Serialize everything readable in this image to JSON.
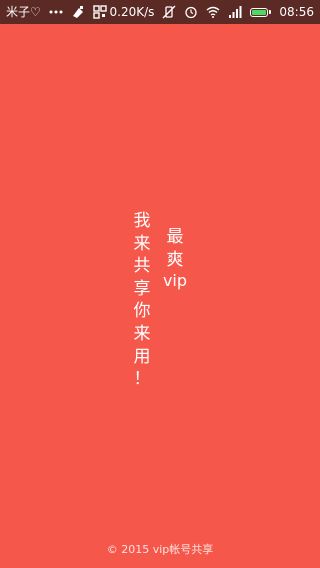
{
  "status_bar": {
    "carrier": "米子♡",
    "network_speed": "0.20K/s",
    "time": "08:56",
    "battery_level_fraction": 0.95,
    "battery_color": "#4cd964"
  },
  "splash": {
    "background_color": "#f5574b",
    "slogan_main_chars": [
      "我",
      "来",
      "共",
      "享",
      "你",
      "来",
      "用",
      "！"
    ],
    "slogan_side_chars": [
      "最",
      "爽"
    ],
    "slogan_side_latin": "vip"
  },
  "footer": {
    "copyright": "© 2015 vip帐号共享"
  }
}
